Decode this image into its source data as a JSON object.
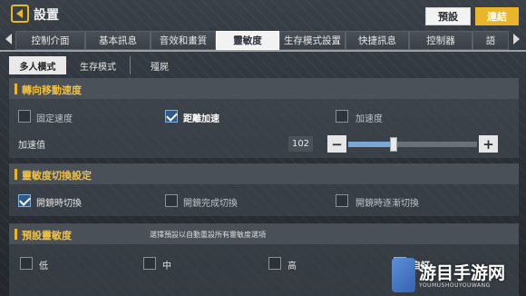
{
  "header": {
    "title": "設置",
    "preset_label": "預設",
    "link_label": "連結"
  },
  "tabs": [
    {
      "label": "控制介面"
    },
    {
      "label": "基本訊息"
    },
    {
      "label": "音效和畫質"
    },
    {
      "label": "靈敏度"
    },
    {
      "label": "生存模式設置"
    },
    {
      "label": "快捷訊息"
    },
    {
      "label": "控制器"
    },
    {
      "label": "語"
    }
  ],
  "subtabs": [
    {
      "label": "多人模式"
    },
    {
      "label": "生存模式"
    },
    {
      "label": "殭屍"
    }
  ],
  "turn_speed": {
    "title": "轉向移動速度",
    "options": [
      {
        "label": "固定速度",
        "checked": false
      },
      {
        "label": "距離加速",
        "checked": true
      },
      {
        "label": "加速度",
        "checked": false
      }
    ],
    "accel_label": "加速值",
    "accel_value": "102",
    "accel_fraction": 0.35
  },
  "sens_switch": {
    "title": "靈敏度切換設定",
    "options": [
      {
        "label": "開鏡時切換",
        "checked": true
      },
      {
        "label": "開鏡完成切換",
        "checked": false
      },
      {
        "label": "開鏡時逐漸切換",
        "checked": false
      }
    ]
  },
  "preset_sens": {
    "title": "預設靈敏度",
    "description": "選擇預設以自動重設所有靈敏度選項",
    "options": [
      {
        "label": "低",
        "checked": false
      },
      {
        "label": "中",
        "checked": false
      },
      {
        "label": "高",
        "checked": false
      },
      {
        "label": "自訂",
        "checked": true
      }
    ]
  },
  "watermark": {
    "text": "游目手游网",
    "sub": "YOUMUSHOUYOUWANG"
  },
  "colors": {
    "accent": "#e9b62b",
    "check_blue": "#2f5a8a"
  }
}
